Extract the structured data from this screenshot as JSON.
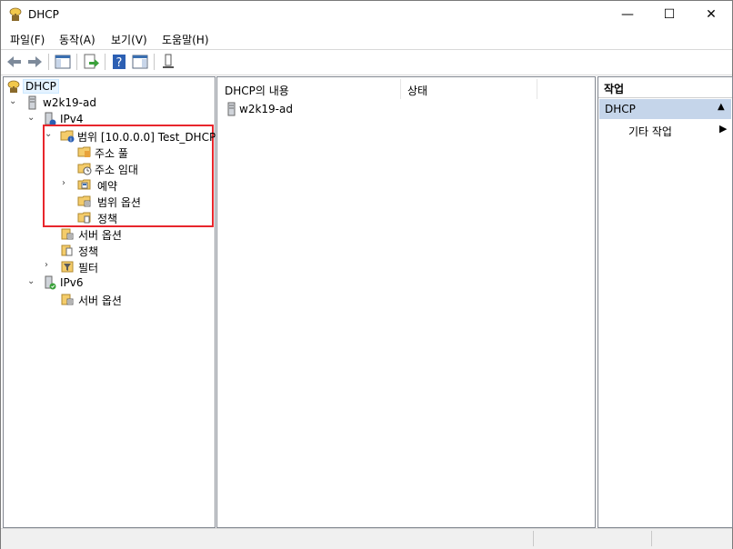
{
  "window": {
    "title": "DHCP"
  },
  "controls": {
    "minimize": "—",
    "maximize": "☐",
    "close": "✕"
  },
  "menu": [
    "파일(F)",
    "동작(A)",
    "보기(V)",
    "도움말(H)"
  ],
  "tree": {
    "root": "DHCP",
    "server": "w2k19-ad",
    "ipv4": "IPv4",
    "scope": "범위 [10.0.0.0] Test_DHCP",
    "scope_children": [
      "주소 풀",
      "주소 임대",
      "예약",
      "범위 옵션",
      "정책"
    ],
    "ipv4_children": [
      "서버 옵션",
      "정책",
      "필터"
    ],
    "ipv6": "IPv6",
    "ipv6_children": [
      "서버 옵션"
    ]
  },
  "content": {
    "columns": [
      "DHCP의 내용",
      "상태"
    ],
    "rows": [
      {
        "name": "w2k19-ad",
        "status": ""
      }
    ]
  },
  "actions": {
    "header": "작업",
    "section": "DHCP",
    "items": [
      "기타 작업"
    ]
  },
  "colors": {
    "highlight_box": "#e8262c",
    "action_section_bg": "#c5d5ea",
    "selected_bg": "#e5f3ff"
  }
}
